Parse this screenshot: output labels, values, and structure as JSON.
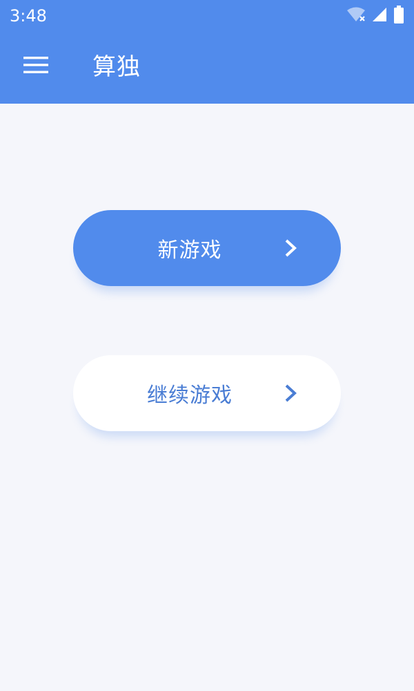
{
  "status_bar": {
    "time": "3:48",
    "icons": [
      "wifi-icon",
      "cellular-signal-icon",
      "battery-icon"
    ]
  },
  "toolbar": {
    "title": "算独",
    "menu_icon": "hamburger-menu-icon"
  },
  "buttons": {
    "new_game_label": "新游戏",
    "continue_game_label": "继续游戏",
    "chevron_icon": "chevron-right-icon"
  },
  "colors": {
    "primary": "#518bec",
    "background": "#f5f6fb",
    "secondary_text": "#4a7dd4",
    "white": "#ffffff"
  }
}
